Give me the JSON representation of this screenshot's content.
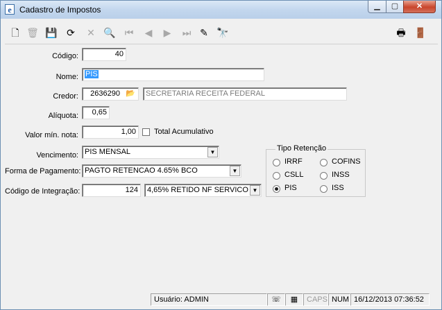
{
  "window": {
    "title": "Cadastro de Impostos",
    "app_icon": "e"
  },
  "toolbar": {
    "items": [
      {
        "name": "new-icon",
        "glyph": "🗋",
        "enabled": true
      },
      {
        "name": "delete-icon",
        "glyph": "🗑",
        "enabled": false
      },
      {
        "name": "save-icon",
        "glyph": "💾",
        "enabled": false
      },
      {
        "name": "refresh-icon",
        "glyph": "⟳",
        "enabled": true
      },
      {
        "name": "cancel-icon",
        "glyph": "✕",
        "enabled": false
      },
      {
        "name": "search-icon",
        "glyph": "🔍",
        "enabled": true
      },
      {
        "name": "first-record-icon",
        "glyph": "⏮",
        "enabled": false
      },
      {
        "name": "prev-record-icon",
        "glyph": "◀",
        "enabled": false
      },
      {
        "name": "next-record-icon",
        "glyph": "▶",
        "enabled": false
      },
      {
        "name": "last-record-icon",
        "glyph": "⏭",
        "enabled": false
      },
      {
        "name": "edit-icon",
        "glyph": "✎",
        "enabled": true
      },
      {
        "name": "binoculars-icon",
        "glyph": "🔭",
        "enabled": false
      }
    ],
    "right_items": [
      {
        "name": "print-icon",
        "glyph": "🖶",
        "enabled": true
      },
      {
        "name": "exit-icon",
        "glyph": "🚪",
        "enabled": true
      }
    ]
  },
  "form": {
    "codigo_label": "Código:",
    "codigo_value": "40",
    "nome_label": "Nome:",
    "nome_value": "PIS",
    "credor_label": "Credor:",
    "credor_code": "2636290",
    "credor_name": "SECRETARIA RECEITA FEDERAL",
    "aliquota_label": "Alíquota:",
    "aliquota_value": "0,65",
    "valor_min_label": "Valor mín. nota:",
    "valor_min_value": "1,00",
    "total_acumulativo_label": "Total Acumulativo",
    "total_acumulativo_checked": false,
    "vencimento_label": "Vencimento:",
    "vencimento_value": "PIS MENSAL",
    "forma_pagamento_label": "Forma de Pagamento:",
    "forma_pagamento_value": "PAGTO RETENCAO 4.65% BCO",
    "codigo_integracao_label": "Código de Integração:",
    "codigo_integracao_value": "124",
    "codigo_integracao_desc": "4,65% RETIDO NF SERVICO (",
    "tipo_retencao": {
      "title": "Tipo Retenção",
      "options": [
        "IRRF",
        "COFINS",
        "CSLL",
        "INSS",
        "PIS",
        "ISS"
      ],
      "selected": "PIS"
    }
  },
  "statusbar": {
    "user": "Usuário: ADMIN",
    "caps": "CAPS",
    "num": "NUM",
    "datetime": "16/12/2013 07:36:52"
  }
}
